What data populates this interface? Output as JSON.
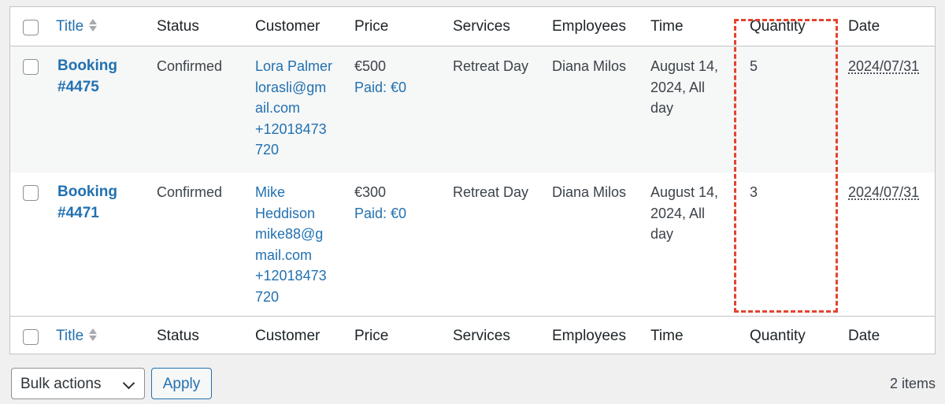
{
  "columns": {
    "title": "Title",
    "status": "Status",
    "customer": "Customer",
    "price": "Price",
    "services": "Services",
    "employees": "Employees",
    "time": "Time",
    "quantity": "Quantity",
    "date": "Date"
  },
  "rows": [
    {
      "title_line1": "Booking",
      "title_line2": "#4475",
      "status": "Confirmed",
      "customer_lines": [
        "Lora Palmer",
        "lorasli@gm",
        "ail.com",
        "+12018473",
        "720"
      ],
      "price": "€500",
      "paid": "Paid: €0",
      "services": "Retreat Day",
      "employees": "Diana Milos",
      "time_lines": [
        "August 14,",
        "2024, All",
        "day"
      ],
      "quantity": "5",
      "date": "2024/07/31"
    },
    {
      "title_line1": "Booking",
      "title_line2": "#4471",
      "status": "Confirmed",
      "customer_lines": [
        "Mike",
        "Heddison",
        "mike88@g",
        "mail.com",
        "+12018473",
        "720"
      ],
      "price": "€300",
      "paid": "Paid: €0",
      "services": "Retreat Day",
      "employees": "Diana Milos",
      "time_lines": [
        "August 14,",
        "2024, All",
        "day"
      ],
      "quantity": "3",
      "date": "2024/07/31"
    }
  ],
  "bulk_actions": {
    "label": "Bulk actions"
  },
  "apply_label": "Apply",
  "items_count": "2 items",
  "colors": {
    "link": "#2271b1",
    "highlight": "#e2442f",
    "border": "#c3c4c7"
  },
  "icons": {
    "sort": "sort-arrows-icon",
    "dropdown": "chevron-down-icon"
  }
}
